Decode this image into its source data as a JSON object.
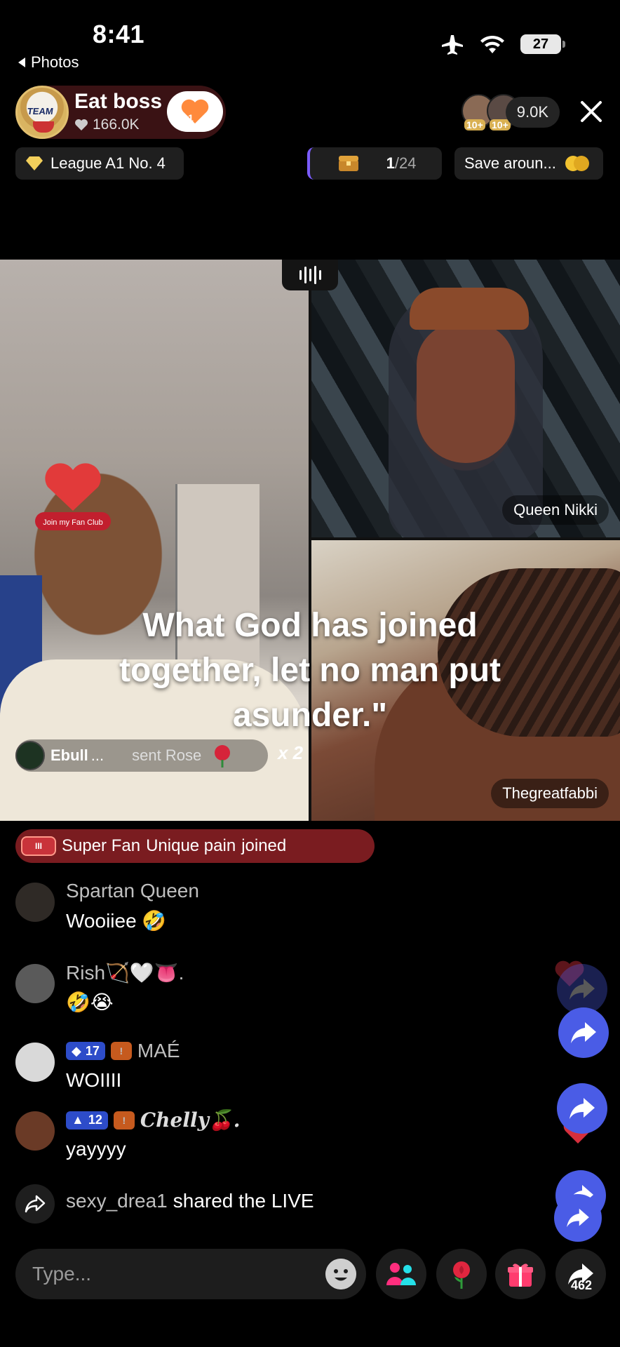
{
  "status_bar": {
    "time": "8:41",
    "back_label": "Photos",
    "battery": "27"
  },
  "host": {
    "name": "Eat boss",
    "likes": "166.0K",
    "avatar_text": "TEAM",
    "follow_badge": "1"
  },
  "viewers": {
    "count": "9.0K",
    "badges": [
      "10+",
      "10+"
    ]
  },
  "pills": {
    "league": "League A1 No. 4",
    "rank_current": "1",
    "rank_total": "/24",
    "save": "Save aroun..."
  },
  "video": {
    "participants": [
      "Queen Nikki",
      "Thegreatfabbi"
    ],
    "fan_club_text": "Join my Fan Club",
    "caption": "What God has joined together, let no man put asunder.\"",
    "gift": {
      "user": "Ebull",
      "suffix": "...",
      "action": "sent Rose",
      "count": "x 2"
    }
  },
  "join_banner": {
    "badge": "Super Fan",
    "user": "Unique pain",
    "action": "joined"
  },
  "comments": [
    {
      "user": "Spartan Queen",
      "text": "Wooiiee 🤣",
      "avatar_color": "#2f2a26"
    },
    {
      "user": "Rish🏹🤍👅.",
      "text": "🤣😭",
      "avatar_color": "#5a5a5a"
    },
    {
      "user": "MAÉ",
      "level": "17",
      "text": "WOIIII",
      "avatar_color": "#d9d9d9"
    },
    {
      "user": "Chelly🍒.",
      "level": "12",
      "text": "yayyyy",
      "avatar_color": "#6a3a26"
    }
  ],
  "share_event": {
    "user": "sexy_drea1",
    "action": "shared the LIVE"
  },
  "bottom_bar": {
    "input_placeholder": "Type...",
    "share_count": "462"
  },
  "colors": {
    "accent_blue": "#4a5ce6",
    "host_card": "#3a1214",
    "join_banner": "#7a1c20",
    "heart": "#ff8a3c"
  },
  "icons": [
    "airplane-icon",
    "wifi-icon",
    "battery-icon",
    "close-icon",
    "heart-icon",
    "diamond-icon",
    "treasure-icon",
    "coin-icon",
    "audio-icon",
    "share-icon",
    "emoji-icon",
    "multi-guest-icon",
    "rose-icon",
    "gift-icon"
  ]
}
